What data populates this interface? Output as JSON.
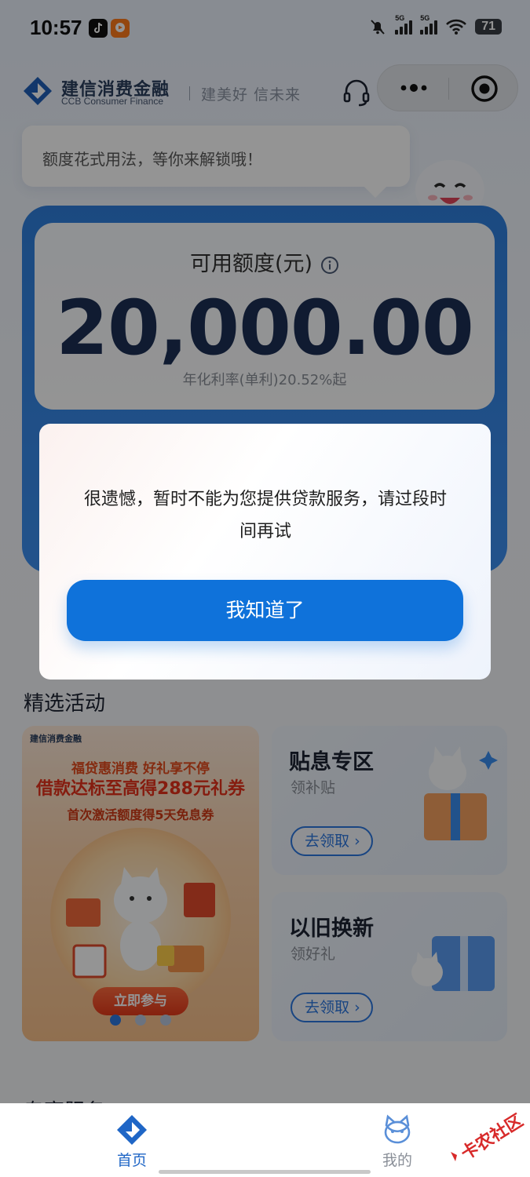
{
  "status_bar": {
    "time": "10:57",
    "signal_1": "5G",
    "signal_2": "5G",
    "battery": "71"
  },
  "header": {
    "brand_cn": "建信消费金融",
    "brand_en": "CCB Consumer Finance",
    "slogan": "建美好 信未来"
  },
  "bubble": {
    "text": "额度花式用法，等你来解锁哦！"
  },
  "credit": {
    "label": "可用额度(元)",
    "amount": "20,000.00",
    "rate": "年化利率(单利)20.52%起"
  },
  "dialog": {
    "message": "很遗憾，暂时不能为您提供贷款服务，请过段时间再试",
    "button": "我知道了"
  },
  "activities": {
    "title": "精选活动",
    "banner": {
      "logo_text": "建信消费金融",
      "line1": "福贷惠消费 好礼享不停",
      "line2": "借款达标至高得288元礼券",
      "line3": "首次激活额度得5天免息券",
      "cta": "立即参与",
      "carousel_total": 3,
      "carousel_active": 1
    },
    "cards": [
      {
        "title": "贴息专区",
        "subtitle": "领补贴",
        "button": "去领取"
      },
      {
        "title": "以旧换新",
        "subtitle": "领好礼",
        "button": "去领取"
      }
    ]
  },
  "next_section": {
    "title": "专享服务"
  },
  "tabbar": {
    "tabs": [
      {
        "label": "首页",
        "active": true
      },
      {
        "label": "我的",
        "active": false
      }
    ]
  },
  "watermark": {
    "text": "卡农社区"
  },
  "colors": {
    "primary": "#0F72DA",
    "card_blue": "#3C8FF0",
    "amount_text": "#1C2F55",
    "promo_red": "#E6311A"
  }
}
